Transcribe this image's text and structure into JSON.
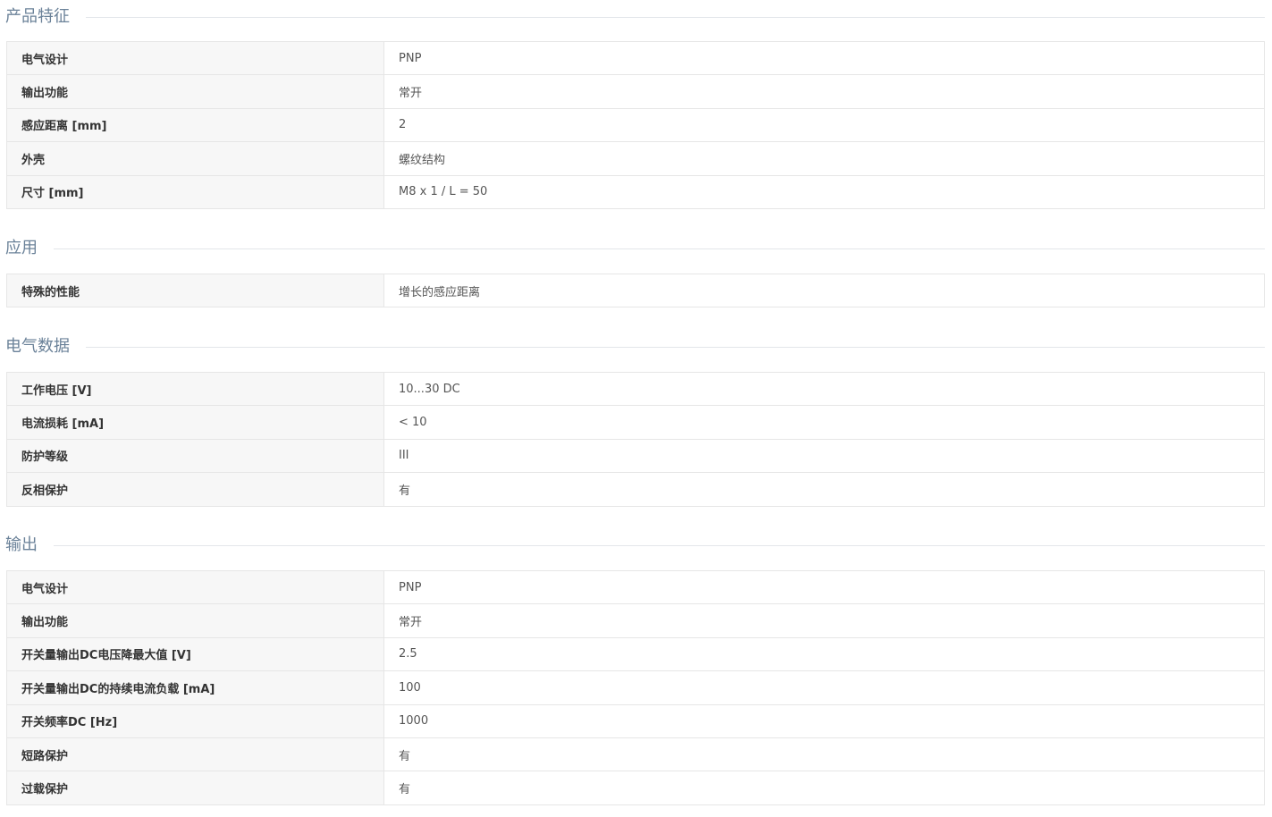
{
  "sections": [
    {
      "title": "产品特征",
      "rows": [
        {
          "label": "电气设计",
          "value": "PNP"
        },
        {
          "label": "输出功能",
          "value": "常开"
        },
        {
          "label": "感应距离 [mm]",
          "value": "2"
        },
        {
          "label": "外壳",
          "value": "螺纹结构"
        },
        {
          "label": "尺寸 [mm]",
          "value": "M8 x 1 / L = 50"
        }
      ]
    },
    {
      "title": "应用",
      "rows": [
        {
          "label": "特殊的性能",
          "value": "增长的感应距离"
        }
      ]
    },
    {
      "title": "电气数据",
      "rows": [
        {
          "label": "工作电压 [V]",
          "value": "10...30 DC"
        },
        {
          "label": "电流损耗 [mA]",
          "value": "< 10"
        },
        {
          "label": "防护等级",
          "value": "III"
        },
        {
          "label": "反相保护",
          "value": "有"
        }
      ]
    },
    {
      "title": "输出",
      "rows": [
        {
          "label": "电气设计",
          "value": "PNP"
        },
        {
          "label": "输出功能",
          "value": "常开"
        },
        {
          "label": "开关量输出DC电压降最大值 [V]",
          "value": "2.5"
        },
        {
          "label": "开关量输出DC的持续电流负载 [mA]",
          "value": "100"
        },
        {
          "label": "开关频率DC [Hz]",
          "value": "1000"
        },
        {
          "label": "短路保护",
          "value": "有"
        },
        {
          "label": "过载保护",
          "value": "有"
        }
      ]
    }
  ]
}
